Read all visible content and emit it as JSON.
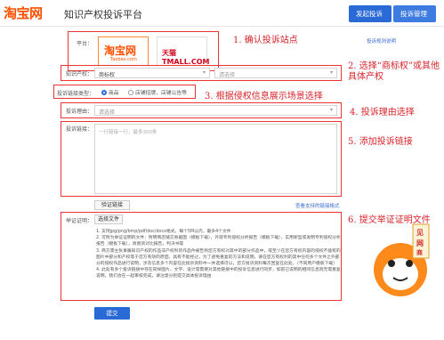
{
  "header": {
    "logo": "淘宝网",
    "title": "知识产权投诉平台",
    "nav": [
      "发起投诉",
      "投诉管理"
    ]
  },
  "platform": {
    "label": "平台：",
    "taobao_name": "淘宝网",
    "taobao_domain": "Taobao.com",
    "tmall_name": "天猫 TMALL.COM",
    "rules_link": "投诉规则说明",
    "annotation": "1. 确认投诉站点"
  },
  "rights": {
    "label": "知识产权：",
    "select_value": "商标权",
    "second_placeholder": "请选择",
    "annotation": "2. 选择“商标权”或其他具体产权"
  },
  "scene": {
    "label": "投诉链接类型：",
    "options": [
      "商品",
      "店铺招牌、店铺公告等"
    ],
    "annotation": "3. 根据侵权信息展示场景选择"
  },
  "reason": {
    "label": "投诉理由：",
    "placeholder": "请选择",
    "annotation": "4. 投诉理由选择"
  },
  "links": {
    "label": "投诉链接：",
    "placeholder": "一行链接一行，最多300条",
    "verify_button": "验证链接",
    "batch_link": "查看支持的链接格式",
    "annotation": "5. 添加投诉链接"
  },
  "evidence": {
    "label": "举证证明：",
    "choose_button": "选择文件",
    "annotation": "6. 提交举证证明文件",
    "notes": [
      "1. 支持jpg/png/bmp/pdf/doc/docx格式，每个5M以内，最多4个文件",
      "2. 可附为举证证明的文件：附明商店铺交易截图（模板下载），外观专利侵权分析报告（模板下载），实用新型或发明专利侵权分析报告（模板下载），真假货对比报告，判决书等",
      "3. 商方需主张事属知识产权的作品非产权利的作品件被告到您方有权对其中的部分作品中，或至少在您方有权内容的侵权不能有的图片中部分和产权等于您方有效的原因，具有不能经过，为了避免重复的方法和说明，请在您方有权利的其中任何多个文件之外部分的侵权作品进行说明，涉及信息多个内容在此投诉资料中一并选择可以，您方投诉资料每次回复在此处，（不同用户模板下载）",
      "4. 此处有多个投诉链接中存在同样图片、文字、设计等需要对其他链接中的投诉信息进行同步，如前已说明的相同信息则无需重复说明，我们会在一起审核完成，请注意分别提交具体投诉理由"
    ]
  },
  "submit": {
    "label": "提交"
  },
  "mascot": {
    "badge": "见",
    "badge2": "网",
    "badge3": "商"
  },
  "colors": {
    "brand_orange": "#ff5000",
    "primary_blue": "#2a6ad6",
    "annotation_red": "#d8232a"
  }
}
